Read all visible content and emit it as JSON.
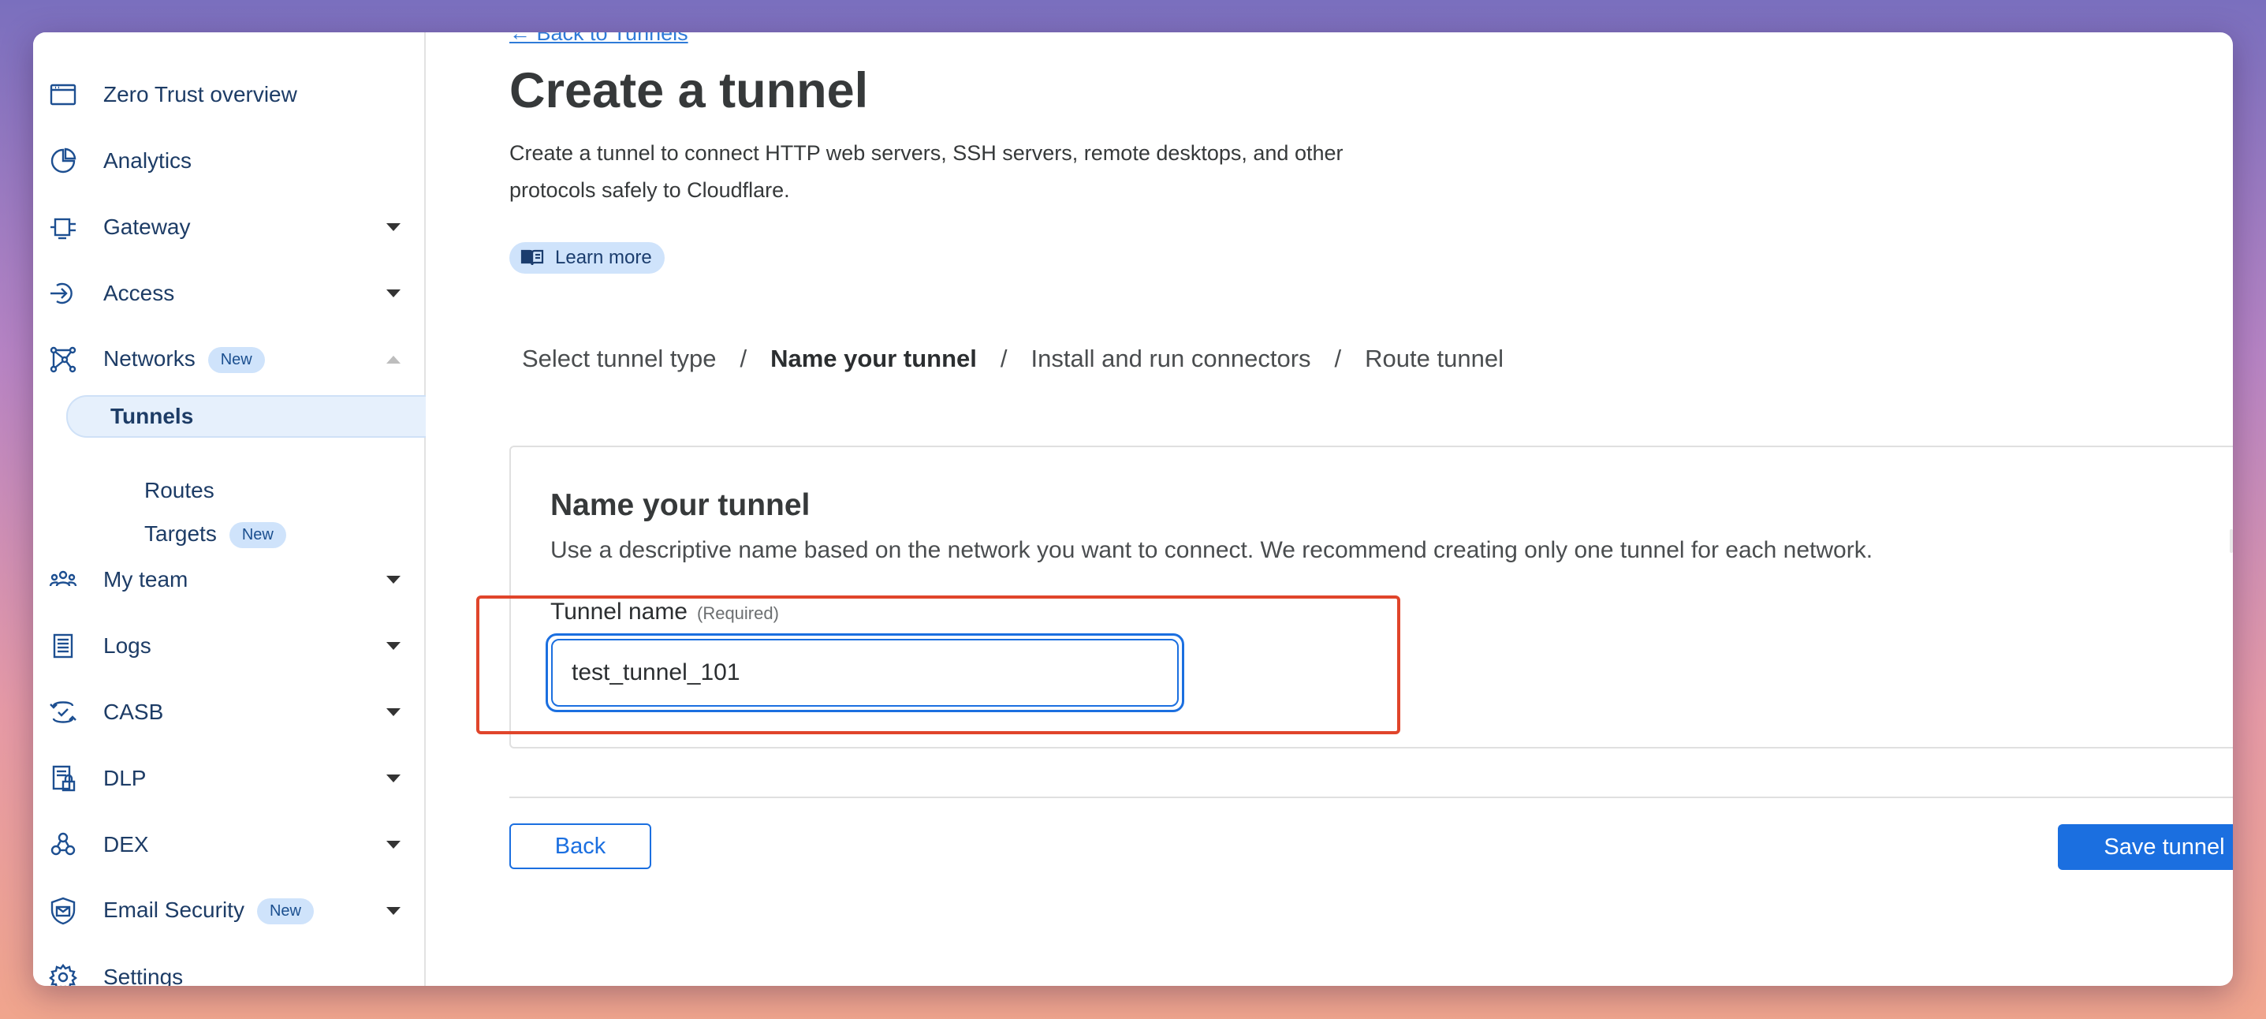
{
  "sidebar": {
    "items": [
      {
        "label": "Zero Trust overview",
        "icon": "window-icon"
      },
      {
        "label": "Analytics",
        "icon": "pie-chart-icon"
      },
      {
        "label": "Gateway",
        "icon": "gateway-icon"
      },
      {
        "label": "Access",
        "icon": "access-icon"
      },
      {
        "label": "Networks",
        "icon": "networks-icon",
        "badge": "New"
      },
      {
        "label": "My team",
        "icon": "team-icon"
      },
      {
        "label": "Logs",
        "icon": "logs-icon"
      },
      {
        "label": "CASB",
        "icon": "casb-icon"
      },
      {
        "label": "DLP",
        "icon": "dlp-icon"
      },
      {
        "label": "DEX",
        "icon": "dex-icon"
      },
      {
        "label": "Email Security",
        "icon": "email-security-icon",
        "badge": "New"
      },
      {
        "label": "Settings",
        "icon": "gear-icon"
      }
    ],
    "networks_sub": [
      {
        "label": "Tunnels",
        "active": true
      },
      {
        "label": "Routes"
      },
      {
        "label": "Targets",
        "badge": "New"
      }
    ]
  },
  "main": {
    "back_link": "← Back to Tunnels",
    "title": "Create a tunnel",
    "description_line1": "Create a tunnel to connect HTTP web servers, SSH servers, remote desktops, and other",
    "description_line2": "protocols safely to Cloudflare.",
    "learn_more": "Learn more",
    "steps": [
      "Select tunnel type",
      "Name your tunnel",
      "Install and run connectors",
      "Route tunnel"
    ],
    "step_separator": "/",
    "current_step": 1,
    "card": {
      "title": "Name your tunnel",
      "description": "Use a descriptive name based on the network you want to connect. We recommend creating only one tunnel for each network.",
      "field_label": "Tunnel name",
      "field_required": "(Required)",
      "field_value": "test_tunnel_101"
    },
    "back_button": "Back",
    "save_button": "Save tunnel"
  },
  "colors": {
    "accent": "#1b6fe0",
    "nav_text": "#1d3c66",
    "badge_bg": "#cfe3fb",
    "highlight": "#e0452b"
  }
}
